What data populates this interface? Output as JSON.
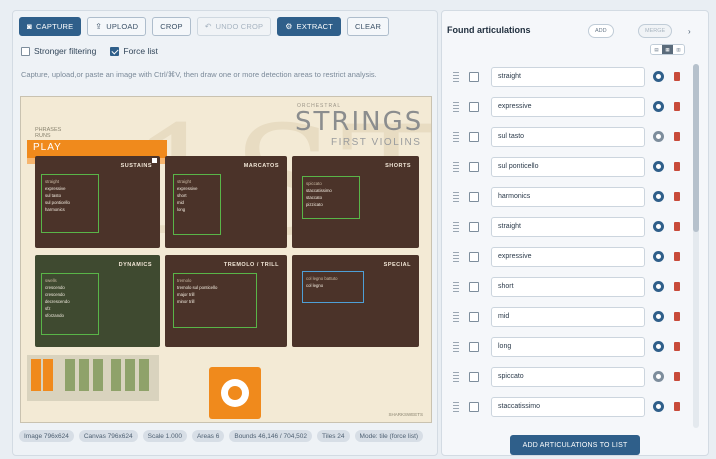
{
  "toolbar": {
    "capture": "CAPTURE",
    "upload": "UPLOAD",
    "crop": "CROP",
    "undo_crop": "UNDO CROP",
    "extract": "EXTRACT",
    "clear": "CLEAR"
  },
  "options": {
    "stronger_filtering": {
      "label": "Stronger filtering",
      "checked": false
    },
    "force_list": {
      "label": "Force list",
      "checked": true
    }
  },
  "hint": "Capture, upload,or paste an image with Ctrl/⌘V, then draw one or more detection areas to restrict analysis.",
  "canvas": {
    "subheading": "ORCHESTRAL",
    "title": "STRINGS",
    "subtitle": "FIRST VIOLINS",
    "side_label_1": "PHRASES",
    "side_label_2": "RUNS",
    "play": "PLAY",
    "categories": [
      {
        "title": "SUSTAINS",
        "items": [
          "straight",
          "expressive",
          "sul tasto",
          "sul ponticello",
          "harmonics"
        ]
      },
      {
        "title": "MARCATOS",
        "items": [
          "straight",
          "expressive",
          "short",
          "mid",
          "long"
        ]
      },
      {
        "title": "SHORTS",
        "items": [
          "spiccato",
          "staccatissimo",
          "staccato",
          "pizzicato"
        ]
      },
      {
        "title": "DYNAMICS",
        "items": [
          "swells",
          "crescendo",
          "crescendo",
          "decrescendo",
          "sfz",
          "sforzando"
        ]
      },
      {
        "title": "TREMOLO / TRILL",
        "items": [
          "tremolo",
          "tremolo sul ponticello",
          "major trill",
          "minor trill"
        ]
      },
      {
        "title": "SPECIAL",
        "items": [
          "col legno battuto",
          "col legno"
        ]
      }
    ],
    "corner_text": "SHARKSWEETS"
  },
  "status": [
    "Image 796x624",
    "Canvas 796x624",
    "Scale 1.000",
    "Areas 6",
    "Bounds 46,146 / 704,502",
    "Tiles 24",
    "Mode: tile (force list)"
  ],
  "panel": {
    "heading": "Found articulations",
    "add_label": "ADD",
    "merge_label": "MERGE",
    "collapse": "›",
    "view_options": [
      "list",
      "grid",
      "tiles"
    ],
    "rows": [
      {
        "text": "straight",
        "visible": true
      },
      {
        "text": "expressive",
        "visible": true
      },
      {
        "text": "sul tasto",
        "visible": false
      },
      {
        "text": "sul ponticello",
        "visible": true
      },
      {
        "text": "harmonics",
        "visible": true
      },
      {
        "text": "straight",
        "visible": true
      },
      {
        "text": "expressive",
        "visible": true
      },
      {
        "text": "short",
        "visible": true
      },
      {
        "text": "mid",
        "visible": true
      },
      {
        "text": "long",
        "visible": true
      },
      {
        "text": "spiccato",
        "visible": false
      },
      {
        "text": "staccatissimo",
        "visible": true
      }
    ],
    "add_to_list": "ADD ARTICULATIONS TO LIST"
  }
}
